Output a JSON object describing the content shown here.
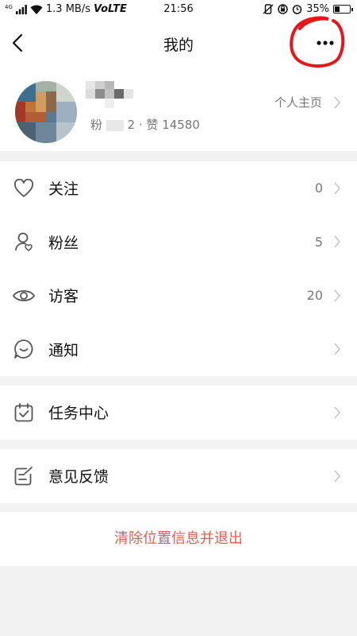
{
  "status_bar": {
    "network": "4G",
    "speed": "1.3 MB/s",
    "volte": "VoLTE",
    "time": "21:56",
    "battery": "35%",
    "battery_level": 0.35
  },
  "header": {
    "title": "我的",
    "back_icon": "chevron-left-icon",
    "more_icon": "more-dots-icon",
    "annotation_color": "#e8161b"
  },
  "profile": {
    "stats_prefix": "粉",
    "stats_mid": "2 · 赞",
    "stats_likes": "14580",
    "homepage_label": "个人主页"
  },
  "menu_group_1": [
    {
      "label": "关注",
      "count": "0",
      "icon": "heart-icon"
    },
    {
      "label": "粉丝",
      "count": "5",
      "icon": "follower-icon"
    },
    {
      "label": "访客",
      "count": "20",
      "icon": "eye-icon"
    },
    {
      "label": "通知",
      "count": "",
      "icon": "message-icon"
    }
  ],
  "menu_group_2": [
    {
      "label": "任务中心",
      "icon": "task-icon"
    }
  ],
  "menu_group_3": [
    {
      "label": "意见反馈",
      "icon": "feedback-icon"
    }
  ],
  "logout": {
    "label": "清除位置信息并退出",
    "color": "#e85c4f"
  }
}
